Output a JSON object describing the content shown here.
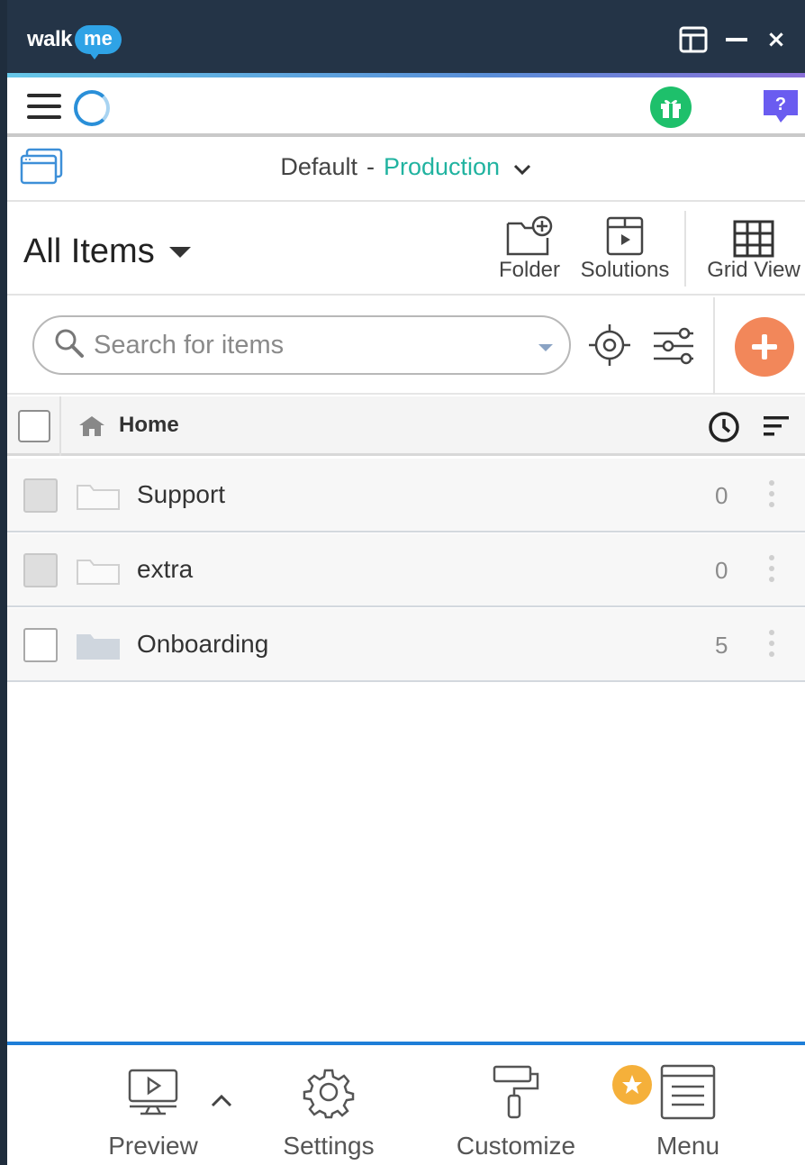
{
  "titlebar": {
    "logo_walk": "walk",
    "logo_me": "me",
    "close_glyph": "×"
  },
  "environment": {
    "name": "Default",
    "separator": "-",
    "stage": "Production",
    "stage_color": "#21b3a0"
  },
  "items_header": {
    "title": "All Items",
    "tools": {
      "folder_label": "Folder",
      "solutions_label": "Solutions",
      "grid_label": "Grid View"
    }
  },
  "search": {
    "placeholder": "Search for items",
    "value": ""
  },
  "list": {
    "breadcrumb": "Home",
    "rows": [
      {
        "name": "Support",
        "count": "0"
      },
      {
        "name": "extra",
        "count": "0"
      },
      {
        "name": "Onboarding",
        "count": "5"
      }
    ]
  },
  "bottom_bar": {
    "preview_label": "Preview",
    "settings_label": "Settings",
    "customize_label": "Customize",
    "menu_label": "Menu"
  },
  "colors": {
    "titlebar": "#243447",
    "accent_blue": "#1e7ed8",
    "add_button": "#f2875a",
    "gift": "#1ec06b",
    "help": "#6a5cf0",
    "menu_badge": "#f5b03a"
  }
}
